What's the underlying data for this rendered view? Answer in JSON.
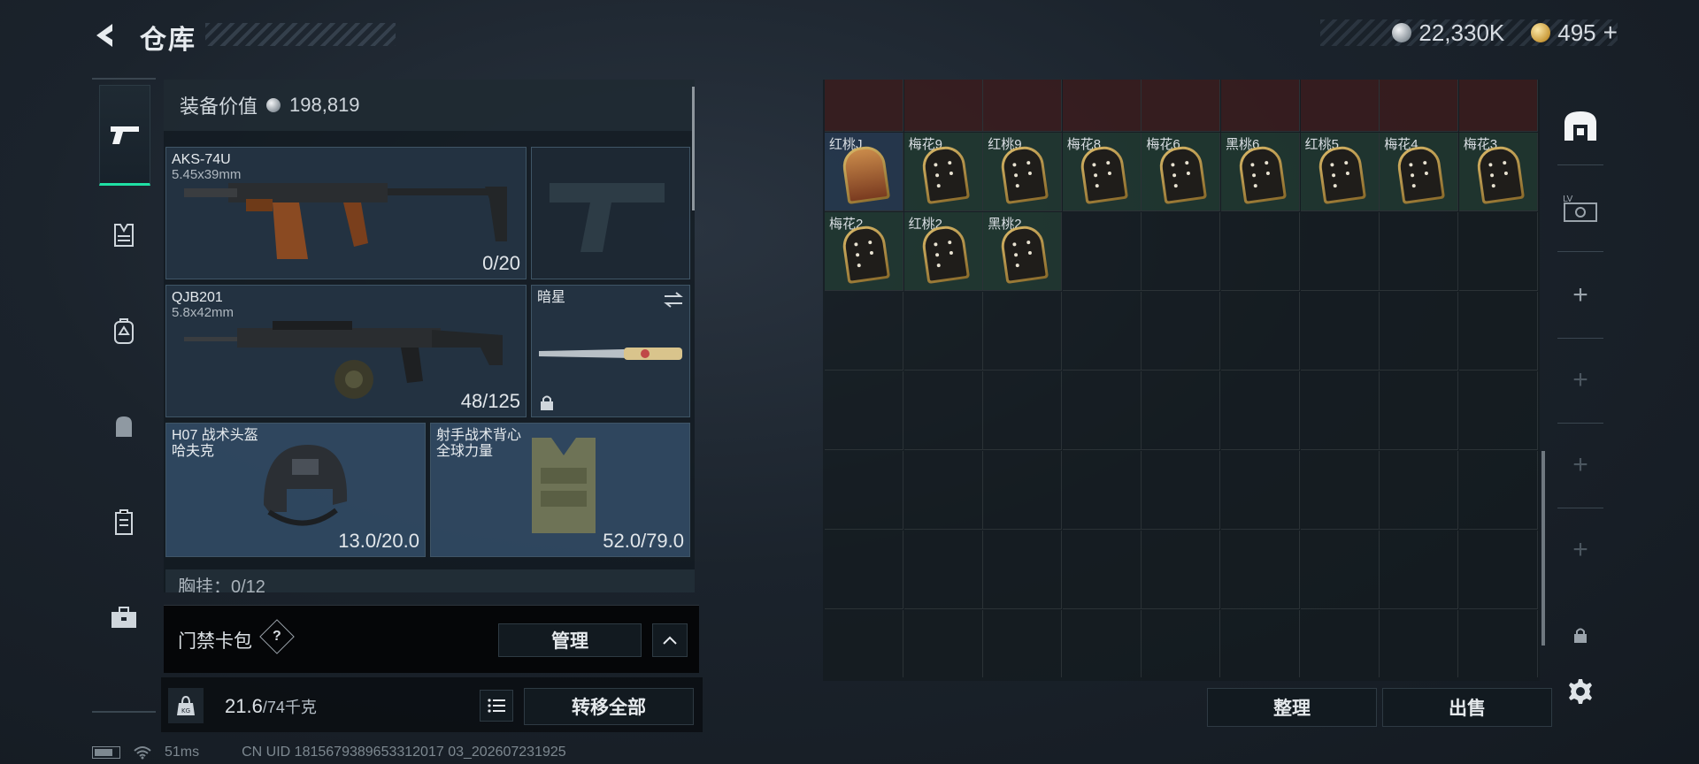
{
  "header": {
    "title": "仓库"
  },
  "currency": {
    "silver": "22,330K",
    "gold": "495",
    "gold_add": "+"
  },
  "equipment": {
    "value_label": "装备价值",
    "value": "198,819",
    "primary": {
      "name": "AKS-74U",
      "caliber": "5.45x39mm",
      "ammo": "0/20"
    },
    "secondary": {
      "name": "QJB201",
      "caliber": "5.8x42mm",
      "ammo": "48/125"
    },
    "melee": {
      "name": "暗星"
    },
    "helmet": {
      "name": "H07 战术头盔",
      "sub": "哈夫克",
      "durability": "13.0/20.0"
    },
    "vest": {
      "name": "射手战术背心",
      "sub": "全球力量",
      "durability": "52.0/79.0"
    },
    "chest_rig": "胸挂：0/12"
  },
  "card_pack": {
    "label": "门禁卡包",
    "help": "?",
    "manage": "管理"
  },
  "weight": {
    "current": "21.6",
    "max": "/74千克",
    "kg_icon": "KG",
    "transfer_all": "转移全部"
  },
  "status": {
    "ping": "51ms",
    "uid": "CN UID 1815679389653312017 03_202607231925"
  },
  "storage": {
    "row1": [
      "红桃J",
      "梅花9",
      "红桃9",
      "梅花8",
      "梅花6",
      "黑桃6",
      "红桃5",
      "梅花4",
      "梅花3"
    ],
    "row2": [
      "梅花2",
      "红桃2",
      "黑桃2"
    ],
    "sort": "整理",
    "sell": "出售"
  },
  "colors": {
    "accent": "#1fe0a4",
    "green_cell": "#28483a",
    "blue_cell": "#2c4460"
  }
}
